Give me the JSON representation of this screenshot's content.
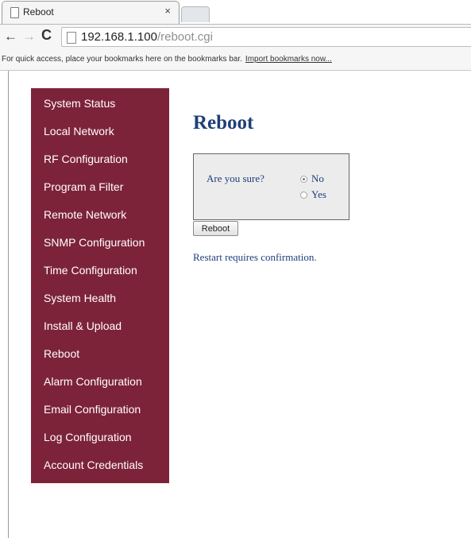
{
  "browser": {
    "tab_title": "Reboot",
    "tab_close": "×",
    "url_host": "192.168.1.100",
    "url_path": "/reboot.cgi",
    "nav_back": "←",
    "nav_forward": "→",
    "nav_reload": "C",
    "bookmarks_message": "For quick access, place your bookmarks here on the bookmarks bar.",
    "bookmarks_import_link": "Import bookmarks now..."
  },
  "sidebar": {
    "color": "#7d2339",
    "items": [
      {
        "label": "System Status"
      },
      {
        "label": "Local Network"
      },
      {
        "label": "RF Configuration"
      },
      {
        "label": "Program a Filter"
      },
      {
        "label": "Remote Network"
      },
      {
        "label": "SNMP Configuration"
      },
      {
        "label": "Time Configuration"
      },
      {
        "label": "System Health"
      },
      {
        "label": "Install & Upload"
      },
      {
        "label": "Reboot"
      },
      {
        "label": "Alarm Configuration"
      },
      {
        "label": "Email Configuration"
      },
      {
        "label": "Log Configuration"
      },
      {
        "label": "Account Credentials"
      }
    ]
  },
  "main": {
    "title": "Reboot",
    "title_color": "#1f3f7a",
    "confirm": {
      "question": "Are you sure?",
      "options": [
        {
          "label": "No",
          "selected": true
        },
        {
          "label": "Yes",
          "selected": false
        }
      ]
    },
    "reboot_button": "Reboot",
    "note": "Restart requires confirmation."
  }
}
